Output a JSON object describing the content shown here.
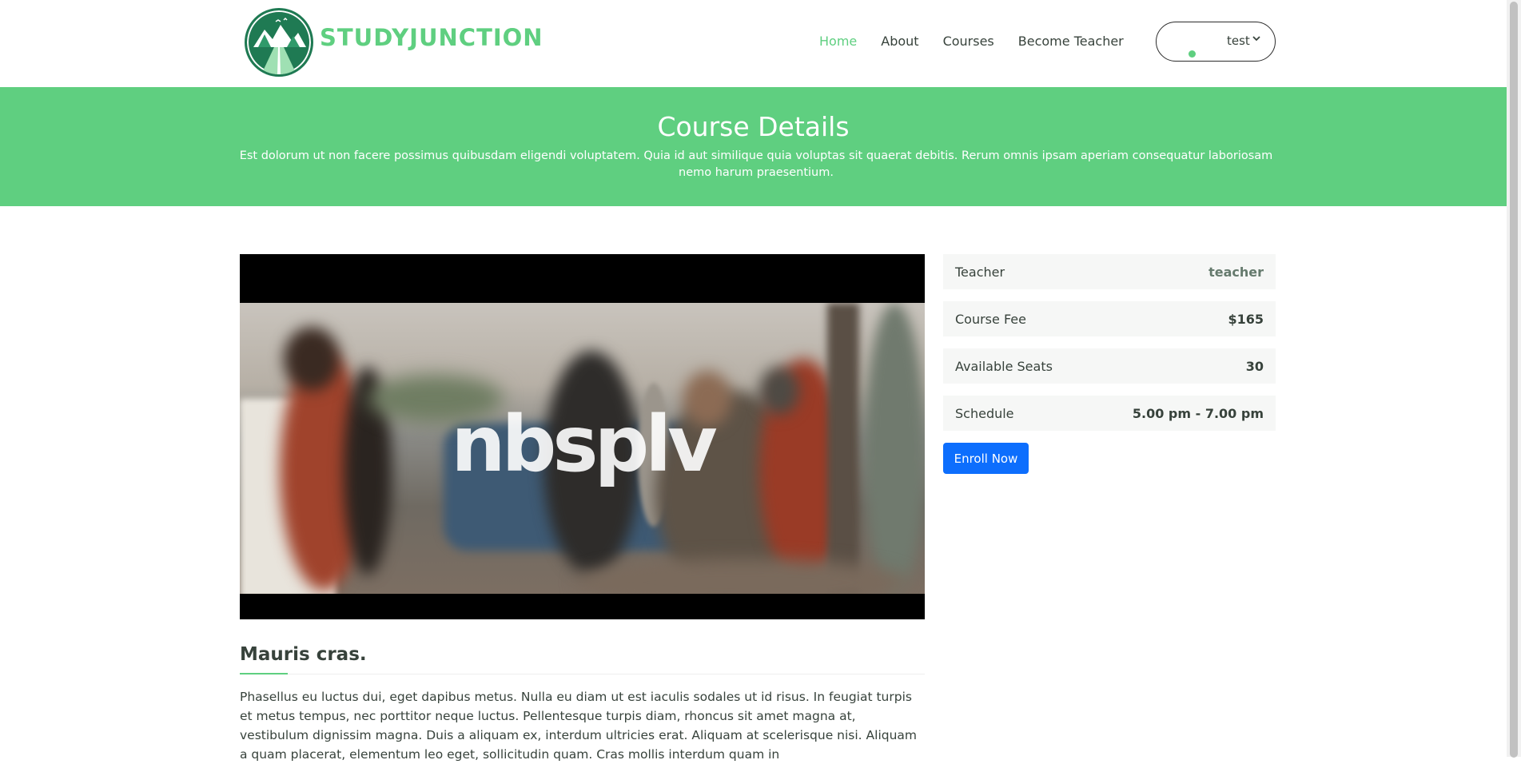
{
  "brand": {
    "name": "STUDYJUNCTION"
  },
  "nav": {
    "items": [
      {
        "label": "Home",
        "active": true
      },
      {
        "label": "About",
        "active": false
      },
      {
        "label": "Courses",
        "active": false
      },
      {
        "label": "Become Teacher",
        "active": false
      }
    ]
  },
  "user": {
    "name": "test"
  },
  "banner": {
    "title": "Course Details",
    "subtitle": "Est dolorum ut non facere possimus quibusdam eligendi voluptatem. Quia id aut similique quia voluptas sit quaerat debitis. Rerum omnis ipsam aperiam consequatur laboriosam nemo harum praesentium."
  },
  "video": {
    "watermark": "nbsplv"
  },
  "info": [
    {
      "label": "Teacher",
      "value": "teacher"
    },
    {
      "label": "Course Fee",
      "value": "$165"
    },
    {
      "label": "Available Seats",
      "value": "30"
    },
    {
      "label": "Schedule",
      "value": "5.00 pm - 7.00 pm"
    }
  ],
  "enroll": {
    "label": "Enroll Now"
  },
  "course": {
    "title": "Mauris cras.",
    "description": "Phasellus eu luctus dui, eget dapibus metus. Nulla eu diam ut est iaculis sodales ut id risus. In feugiat turpis et metus tempus, nec porttitor neque luctus. Pellentesque turpis diam, rhoncus sit amet magna at, vestibulum dignissim magna. Duis a aliquam ex, interdum ultricies erat. Aliquam at scelerisque nisi. Aliquam a quam placerat, elementum leo eget, sollicitudin quam. Cras mollis interdum quam in"
  },
  "colors": {
    "accent": "#5fcf80",
    "primary_button": "#0d6efd",
    "text": "#37423b",
    "logo_green": "#1f7a53"
  }
}
